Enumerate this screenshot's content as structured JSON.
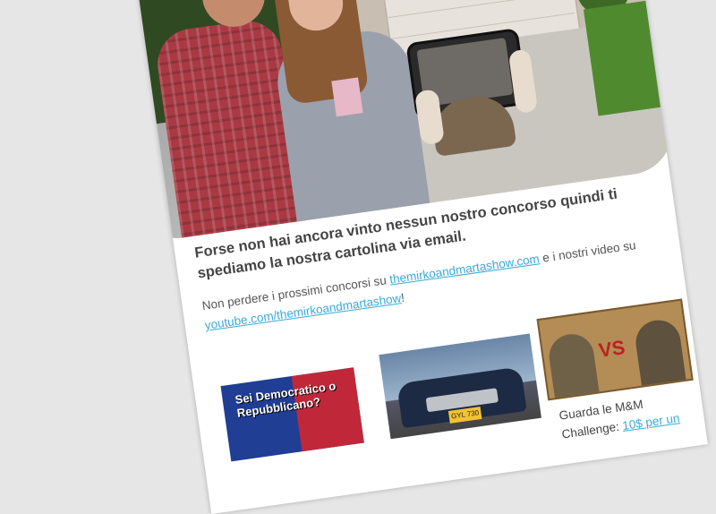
{
  "email": {
    "headline": "Forse non hai ancora vinto nessun nostro concorso quindi ti spediamo la nostra cartolina via email.",
    "intro": {
      "before": "Non perdere i prossimi concorsi su ",
      "link1": "themirkoandmartashow.com",
      "middle": " e i nostri video su ",
      "link2": "youtube.com/themirkoandmartashow",
      "after": "!"
    },
    "hero": {
      "icon": "couple-photo"
    },
    "tiles": [
      {
        "thumb_text": "Sei Democratico o Repubblicano?"
      },
      {
        "plate": "GYL 730"
      },
      {
        "thumb_text": "VS",
        "caption_before": "Guarda le M&M Challenge: ",
        "caption_link": "10$ per un"
      }
    ]
  }
}
